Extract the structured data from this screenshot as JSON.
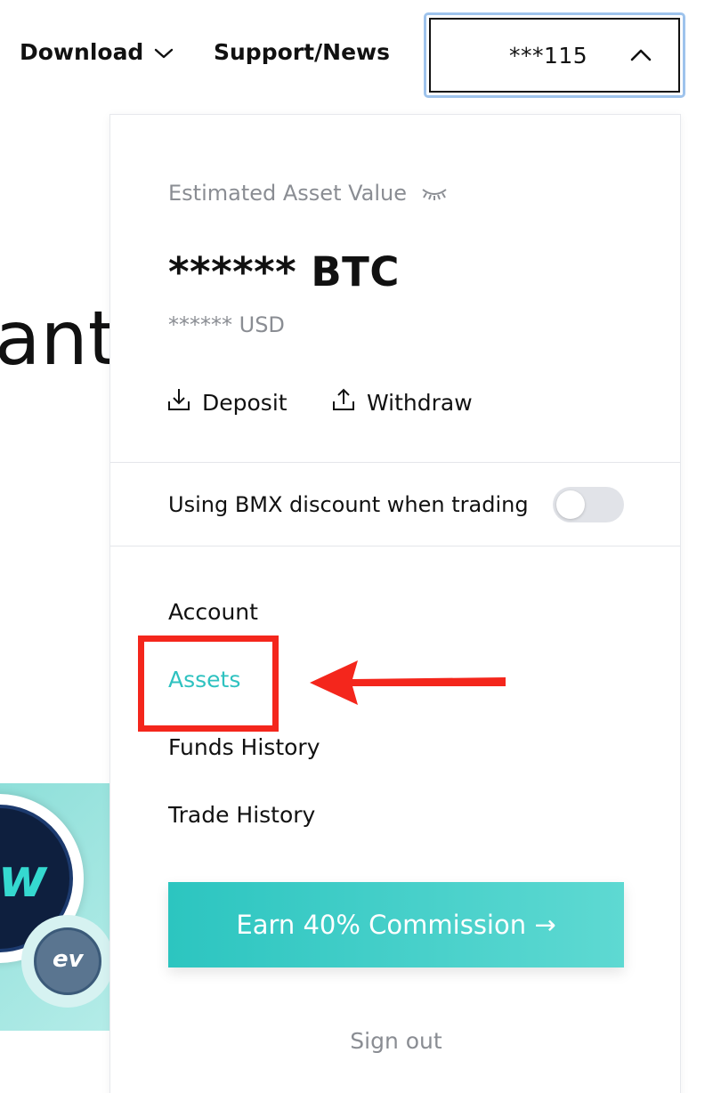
{
  "nav": {
    "download_label": "Download",
    "support_label": "Support/News",
    "account_label": "***115"
  },
  "background": {
    "hero_text_fragment": "ant"
  },
  "panel": {
    "estimated_label": "Estimated Asset Value",
    "btc_value": "****** BTC",
    "usd_value": "****** USD",
    "deposit_label": "Deposit",
    "withdraw_label": "Withdraw",
    "bmx_discount_label": "Using BMX discount when trading",
    "bmx_discount_enabled": false,
    "menu": [
      {
        "label": "Account",
        "active": false
      },
      {
        "label": "Assets",
        "active": true
      },
      {
        "label": "Funds History",
        "active": false
      },
      {
        "label": "Trade History",
        "active": false
      }
    ],
    "earn_label": "Earn 40% Commission →",
    "signout_label": "Sign out"
  },
  "colors": {
    "accent": "#2fc2c0",
    "annotation": "#f4261c",
    "muted_text": "#8a8d93"
  },
  "icons": [
    "chevron-down-icon",
    "chevron-up-icon",
    "eye-hidden-icon",
    "download-tray-icon",
    "upload-tray-icon",
    "arrow-right-icon"
  ]
}
